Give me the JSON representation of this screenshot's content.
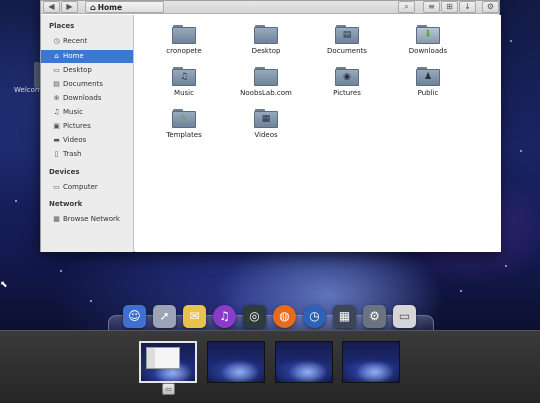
{
  "desktop": {
    "welcome_text": "Welcom"
  },
  "file_manager": {
    "toolbar": {
      "back_glyph": "◀",
      "forward_glyph": "▶",
      "location_label": "Home",
      "search_glyph": "⌕",
      "list_view_glyph": "≡",
      "grid_view_glyph": "⊞",
      "sort_glyph": "↓",
      "settings_glyph": "⚙"
    },
    "sidebar": {
      "sections": [
        {
          "heading": "Places",
          "items": [
            {
              "label": "Recent",
              "icon": "clock-icon",
              "glyph": "◷"
            },
            {
              "label": "Home",
              "icon": "home-icon",
              "glyph": "⌂",
              "active": true
            },
            {
              "label": "Desktop",
              "icon": "desktop-icon",
              "glyph": "▭"
            },
            {
              "label": "Documents",
              "icon": "documents-icon",
              "glyph": "▤"
            },
            {
              "label": "Downloads",
              "icon": "downloads-icon",
              "glyph": "⊕"
            },
            {
              "label": "Music",
              "icon": "music-icon",
              "glyph": "♫"
            },
            {
              "label": "Pictures",
              "icon": "pictures-icon",
              "glyph": "▣"
            },
            {
              "label": "Videos",
              "icon": "videos-icon",
              "glyph": "▬"
            },
            {
              "label": "Trash",
              "icon": "trash-icon",
              "glyph": "▯"
            }
          ]
        },
        {
          "heading": "Devices",
          "items": [
            {
              "label": "Computer",
              "icon": "computer-icon",
              "glyph": "▭"
            }
          ]
        },
        {
          "heading": "Network",
          "items": [
            {
              "label": "Browse Network",
              "icon": "network-icon",
              "glyph": "▦"
            }
          ]
        }
      ]
    },
    "files": [
      {
        "label": "cronopete",
        "icon": "folder-icon",
        "emblem": ""
      },
      {
        "label": "Desktop",
        "icon": "folder-icon",
        "emblem": ""
      },
      {
        "label": "Documents",
        "icon": "folder-icon",
        "emblem": "▤"
      },
      {
        "label": "Downloads",
        "icon": "folder-downloads-icon",
        "emblem": "⬇"
      },
      {
        "label": "Music",
        "icon": "folder-music-icon",
        "emblem": "♫"
      },
      {
        "label": "NoobsLab.com",
        "icon": "folder-icon",
        "emblem": ""
      },
      {
        "label": "Pictures",
        "icon": "folder-pictures-icon",
        "emblem": "◉"
      },
      {
        "label": "Public",
        "icon": "folder-public-icon",
        "emblem": "♟"
      },
      {
        "label": "Templates",
        "icon": "folder-templates-icon",
        "emblem": "✎"
      },
      {
        "label": "Videos",
        "icon": "folder-videos-icon",
        "emblem": "▦"
      }
    ]
  },
  "dock": {
    "icons": [
      {
        "name": "finder-icon",
        "glyph": "☺",
        "color": "#3f6fd0"
      },
      {
        "name": "rocket-launcher-icon",
        "glyph": "➚",
        "color": "#9aa4b4"
      },
      {
        "name": "mail-icon",
        "glyph": "✉",
        "color": "#e8c24a"
      },
      {
        "name": "itunes-icon",
        "glyph": "♫",
        "color": "#8a3cc8"
      },
      {
        "name": "dashboard-icon",
        "glyph": "◎",
        "color": "#2f3a3a"
      },
      {
        "name": "firefox-icon",
        "glyph": "◍",
        "color": "#e86a1a"
      },
      {
        "name": "time-machine-icon",
        "glyph": "◷",
        "color": "#2a63b8"
      },
      {
        "name": "workspace-switcher-icon",
        "glyph": "▦",
        "color": "#3d4658"
      },
      {
        "name": "system-preferences-icon",
        "glyph": "⚙",
        "color": "#6b7280"
      },
      {
        "name": "drive-icon",
        "glyph": "▭",
        "color": "#d6d6d6"
      }
    ]
  },
  "workspaces": {
    "count": 4,
    "active_index": 0,
    "badge_glyph": "▭"
  }
}
